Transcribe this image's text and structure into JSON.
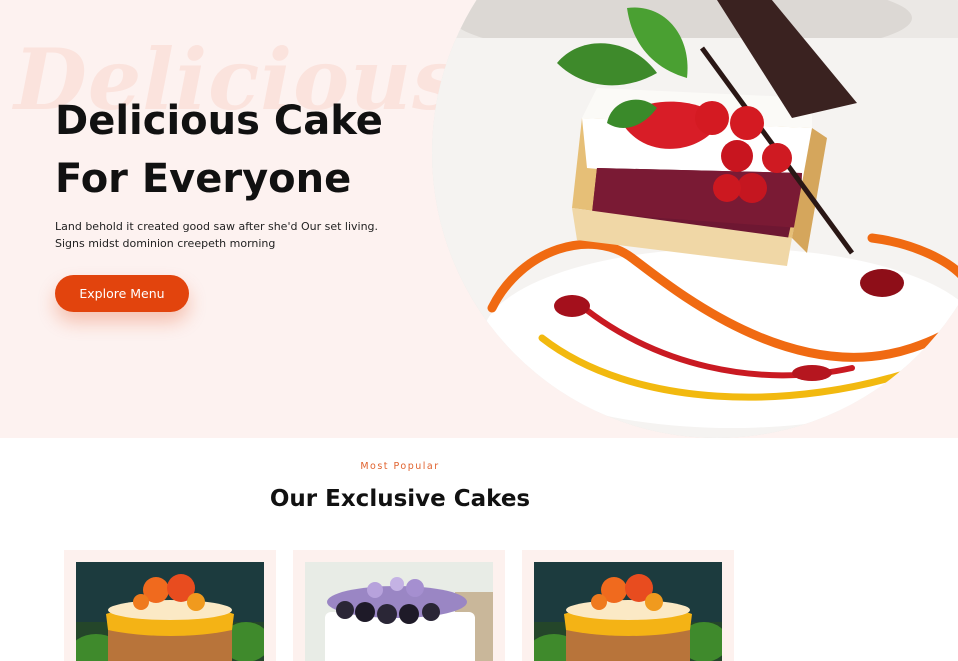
{
  "hero": {
    "watermark": "Delicious",
    "title": "Delicious Cake For Everyone",
    "subtitle": "Land behold it created good saw after she'd Our set living. Signs midst dominion creepeth morning",
    "cta_label": "Explore Menu"
  },
  "section": {
    "kicker": "Most Popular",
    "title": "Our Exclusive Cakes"
  },
  "cards": [
    {
      "image": "orange-fruit-cake-photo"
    },
    {
      "image": "blackberry-lavender-cake-photo"
    },
    {
      "image": "orange-fruit-cake-photo"
    }
  ],
  "colors": {
    "accent": "#e2440d",
    "hero_background": "#fdf2f0",
    "kicker": "#e0622e",
    "card_background": "#fdf1ee"
  }
}
